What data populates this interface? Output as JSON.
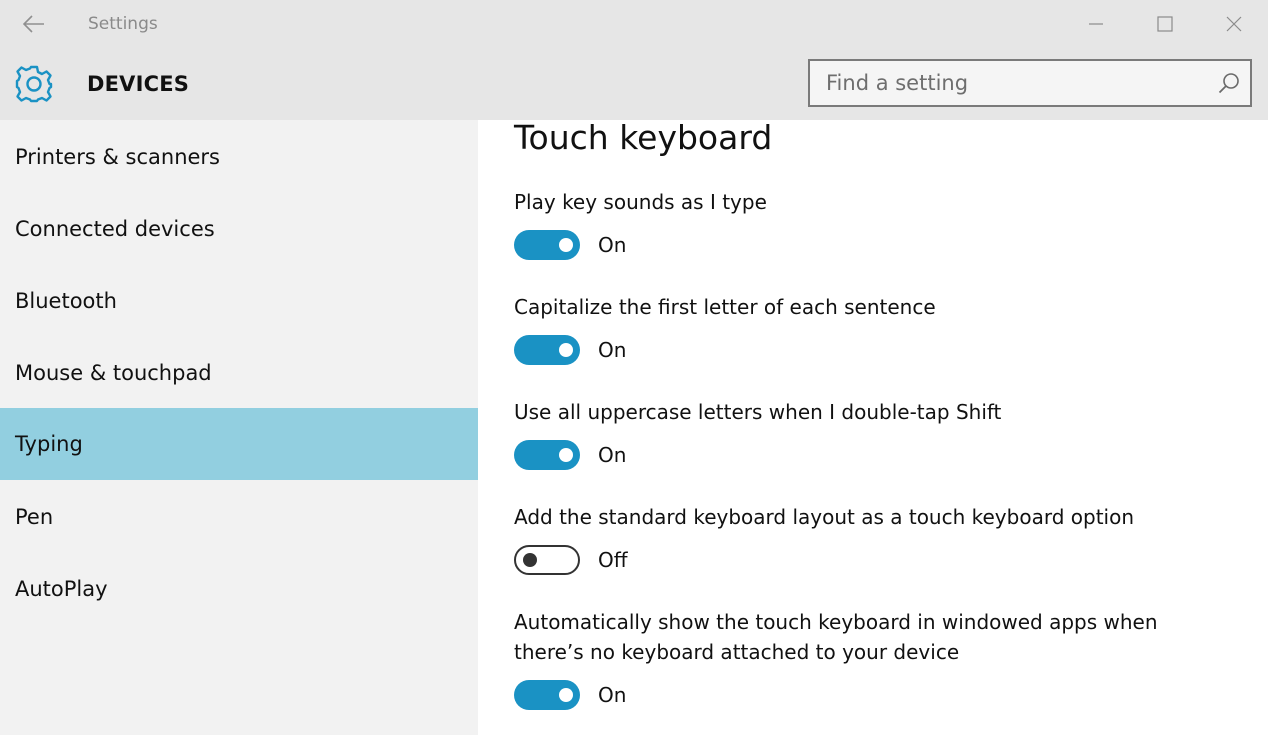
{
  "window": {
    "title": "Settings"
  },
  "header": {
    "section": "DEVICES",
    "search_placeholder": "Find a setting"
  },
  "sidebar": {
    "items": [
      {
        "label": "Printers & scanners",
        "selected": false
      },
      {
        "label": "Connected devices",
        "selected": false
      },
      {
        "label": "Bluetooth",
        "selected": false
      },
      {
        "label": "Mouse & touchpad",
        "selected": false
      },
      {
        "label": "Typing",
        "selected": true
      },
      {
        "label": "Pen",
        "selected": false
      },
      {
        "label": "AutoPlay",
        "selected": false
      }
    ]
  },
  "content": {
    "title": "Touch keyboard",
    "settings": [
      {
        "label": "Play key sounds as I type",
        "state": "On"
      },
      {
        "label": "Capitalize the first letter of each sentence",
        "state": "On"
      },
      {
        "label": "Use all uppercase letters when I double-tap Shift",
        "state": "On"
      },
      {
        "label": "Add the standard keyboard layout as a touch keyboard option",
        "state": "Off"
      },
      {
        "label": "Automatically show the touch keyboard in windowed apps when there’s no keyboard attached to your device",
        "state": "On"
      }
    ]
  },
  "colors": {
    "accent": "#1a92c4",
    "selected_nav": "#92cfe0"
  },
  "icons": {
    "back": "back-arrow-icon",
    "header": "gear-icon",
    "search": "search-icon",
    "minimize": "minimize-icon",
    "maximize": "maximize-icon",
    "close": "close-icon"
  }
}
